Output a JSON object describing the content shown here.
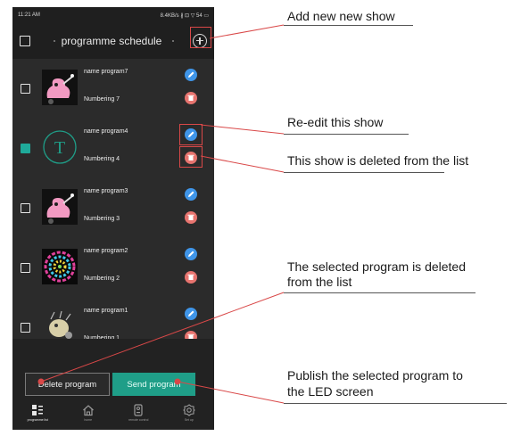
{
  "status_bar": {
    "time": "11:21 AM",
    "right": "8.4KB/s ∦ ⊡ ▽ 54 ▭"
  },
  "header": {
    "title": "programme schedule"
  },
  "programs": [
    {
      "name": "name program7",
      "numbering": "Numbering 7",
      "checked": false,
      "thumb": "pink-bird"
    },
    {
      "name": "name program4",
      "numbering": "Numbering 4",
      "checked": true,
      "thumb": "letter-T",
      "thumb_letter": "T"
    },
    {
      "name": "name program3",
      "numbering": "Numbering 3",
      "checked": false,
      "thumb": "pink-bird"
    },
    {
      "name": "name program2",
      "numbering": "Numbering 2",
      "checked": false,
      "thumb": "colorful-swirl"
    },
    {
      "name": "name program1",
      "numbering": "Numbering 1",
      "checked": false,
      "thumb": "creature"
    }
  ],
  "actions": {
    "delete_label": "Delete program",
    "send_label": "Send program"
  },
  "nav": [
    {
      "label": "programme list",
      "icon": "list-icon",
      "active": true
    },
    {
      "label": "home",
      "icon": "home-icon",
      "active": false
    },
    {
      "label": "remote control",
      "icon": "remote-icon",
      "active": false
    },
    {
      "label": "Set up",
      "icon": "settings-icon",
      "active": false
    }
  ],
  "annotations": {
    "add": "Add new new show",
    "reedit": "Re-edit this show",
    "deleted": "This show is deleted from the list",
    "selected_deleted_l1": "The selected program is deleted",
    "selected_deleted_l2": "from the list",
    "publish_l1": "Publish the selected program to",
    "publish_l2": "the LED screen"
  },
  "colors": {
    "accent_teal": "#1f9e88",
    "edit_blue": "#3f95e8",
    "delete_red": "#e7746f",
    "annotation_red": "#d94848"
  }
}
